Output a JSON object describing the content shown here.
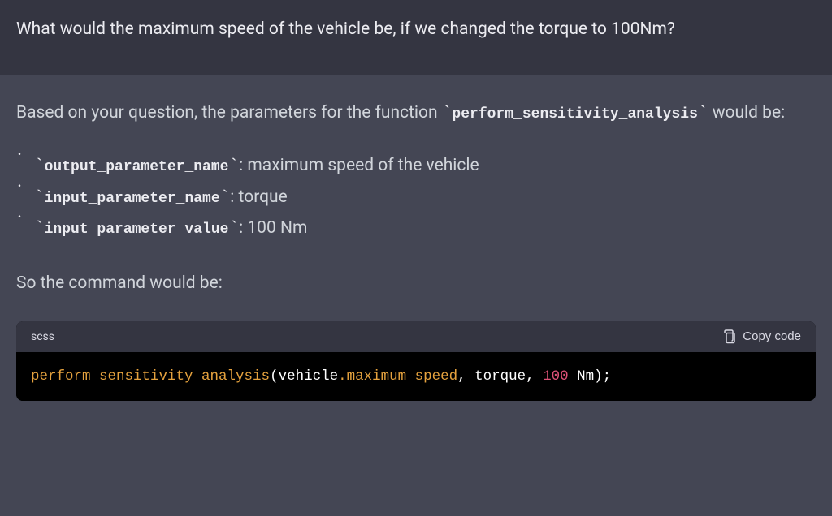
{
  "user": {
    "question": "What would the maximum speed of the vehicle be, if we changed the torque to 100Nm?"
  },
  "assistant": {
    "intro_prefix": "Based on your question, the parameters for the function ",
    "intro_code": "perform_sensitivity_analysis",
    "intro_suffix": " would be:",
    "params": [
      {
        "name": "output_parameter_name",
        "value": ": maximum speed of the vehicle"
      },
      {
        "name": "input_parameter_name",
        "value": ": torque"
      },
      {
        "name": "input_parameter_value",
        "value": ": 100 Nm"
      }
    ],
    "so_command": "So the command would be:",
    "code": {
      "lang": "scss",
      "copy_label": "Copy code",
      "tokens": {
        "func": "perform_sensitivity_analysis",
        "open": "(vehicle",
        "dot_prop": ".maximum_speed",
        "comma1": ", torque, ",
        "num": "100",
        "tail": " Nm);"
      }
    }
  },
  "backtick": "`"
}
